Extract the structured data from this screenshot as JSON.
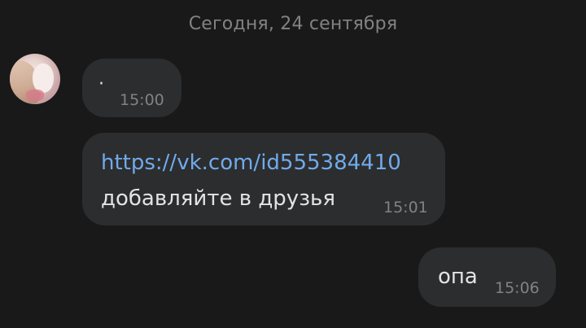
{
  "date_separator": "Сегодня, 24 сентября",
  "contact": {
    "avatar_icon": "user-avatar-icon"
  },
  "messages": [
    {
      "direction": "incoming",
      "text": "·",
      "time": "15:00"
    },
    {
      "direction": "incoming",
      "link": "https://vk.com/id555384410",
      "text": "добавляйте в друзья",
      "time": "15:01"
    },
    {
      "direction": "outgoing",
      "text": "опа",
      "time": "15:06"
    }
  ],
  "colors": {
    "background": "#19191a",
    "bubble": "#2c2d2e",
    "text": "#e1e3e6",
    "secondary_text": "#828282",
    "link": "#71aaeb"
  }
}
